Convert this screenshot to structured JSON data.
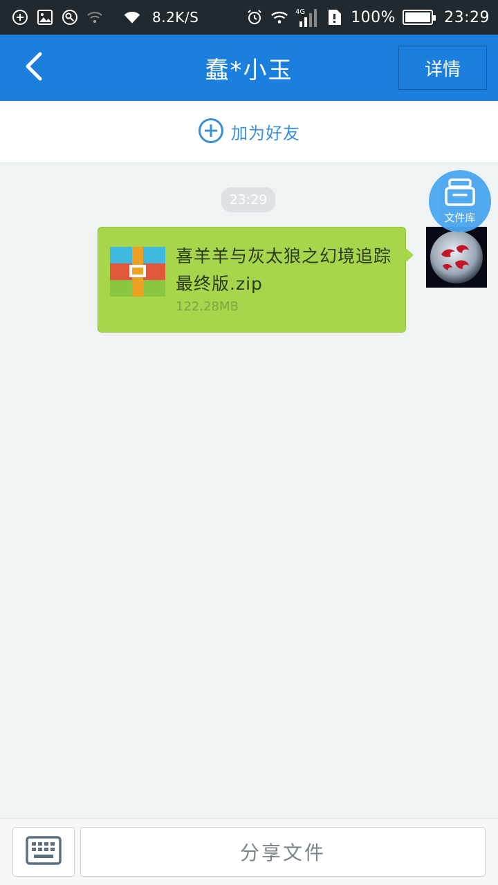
{
  "status_bar": {
    "net_speed": "8.2K/S",
    "network_type": "4G",
    "battery": "100%",
    "time": "23:29",
    "icons": [
      "add-circle-icon",
      "image-icon",
      "vpn-icon",
      "wifi-weak-icon",
      "wifi-icon",
      "alarm-icon",
      "wifi-icon",
      "signal-icon",
      "sim-icon",
      "battery-icon"
    ]
  },
  "header": {
    "title": "蠢*小玉",
    "details_label": "详情",
    "back_icon": "back-arrow-icon"
  },
  "add_friend": {
    "label": "加为好友",
    "icon": "plus-circle-icon"
  },
  "chat": {
    "timestamp": "23:29",
    "message": {
      "file_name": "喜羊羊与灰太狼之幻境追踪最终版.zip",
      "file_size": "122.28MB",
      "file_icon": "zip-archive-icon"
    }
  },
  "file_library": {
    "label": "文件库",
    "icon": "file-cabinet-icon"
  },
  "bottom_bar": {
    "keyboard_icon": "keyboard-icon",
    "share_label": "分享文件"
  },
  "colors": {
    "header": "#1c7fde",
    "bubble": "#a7d64d",
    "accent": "#3a8ed4"
  }
}
